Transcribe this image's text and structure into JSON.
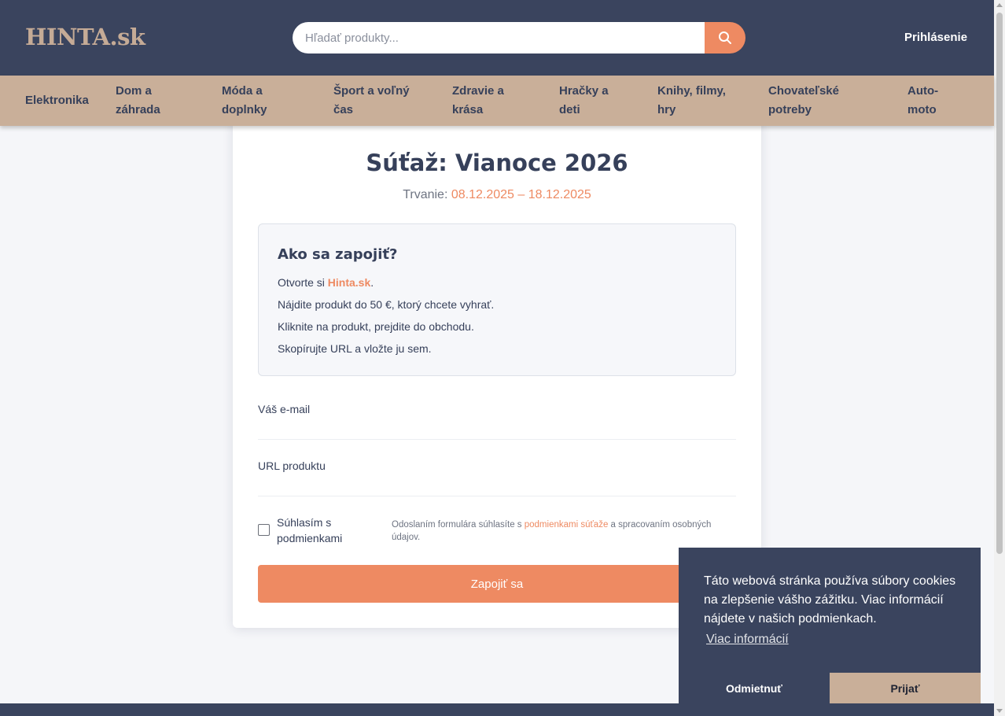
{
  "header": {
    "logo": "HINTA.sk",
    "search": {
      "placeholder": "Hľadať produkty..."
    },
    "login_label": "Prihlásenie"
  },
  "categories": [
    "Elektronika",
    "Dom a záhrada",
    "Móda a doplnky",
    "Šport a voľný čas",
    "Zdravie a krása",
    "Hračky a deti",
    "Knihy, filmy, hry",
    "Chovateľské potreby",
    "Auto-moto"
  ],
  "contest": {
    "title": "Súťaž: Vianoce 2026",
    "duration_label": "Trvanie:",
    "duration_dates": "08.12.2025 – 18.12.2025",
    "howto": {
      "title": "Ako sa zapojiť?",
      "step1_prefix": "Otvorte si ",
      "step1_link": "Hinta.sk",
      "step1_suffix": ".",
      "step2": "Nájdite produkt do 50 €, ktorý chcete vyhrať.",
      "step3": "Kliknite na produkt, prejdite do obchodu.",
      "step4": "Skopírujte URL a vložte ju sem."
    },
    "form": {
      "email_label": "Váš e-mail",
      "email_value": "",
      "url_label": "URL produktu",
      "url_value": "",
      "agree_label": "Súhlasím s podmienkami",
      "note_prefix": "Odoslaním formulára súhlasíte s ",
      "note_link": "podmienkami súťaže",
      "note_suffix": " a spracovaním osobných údajov.",
      "submit_label": "Zapojiť sa"
    }
  },
  "cookie_banner": {
    "text": "Táto webová stránka používa súbory cookies na zlepšenie vášho zážitku. Viac informácií nájdete v našich podmienkach.",
    "more_link": "Viac informácií",
    "deny_label": "Odmietnuť",
    "accept_label": "Prijať"
  },
  "icons": {
    "search": "search-icon"
  },
  "colors": {
    "navy": "#3a445e",
    "tan": "#c9af99",
    "accent": "#ee8a62",
    "background": "#f5f6f9"
  }
}
